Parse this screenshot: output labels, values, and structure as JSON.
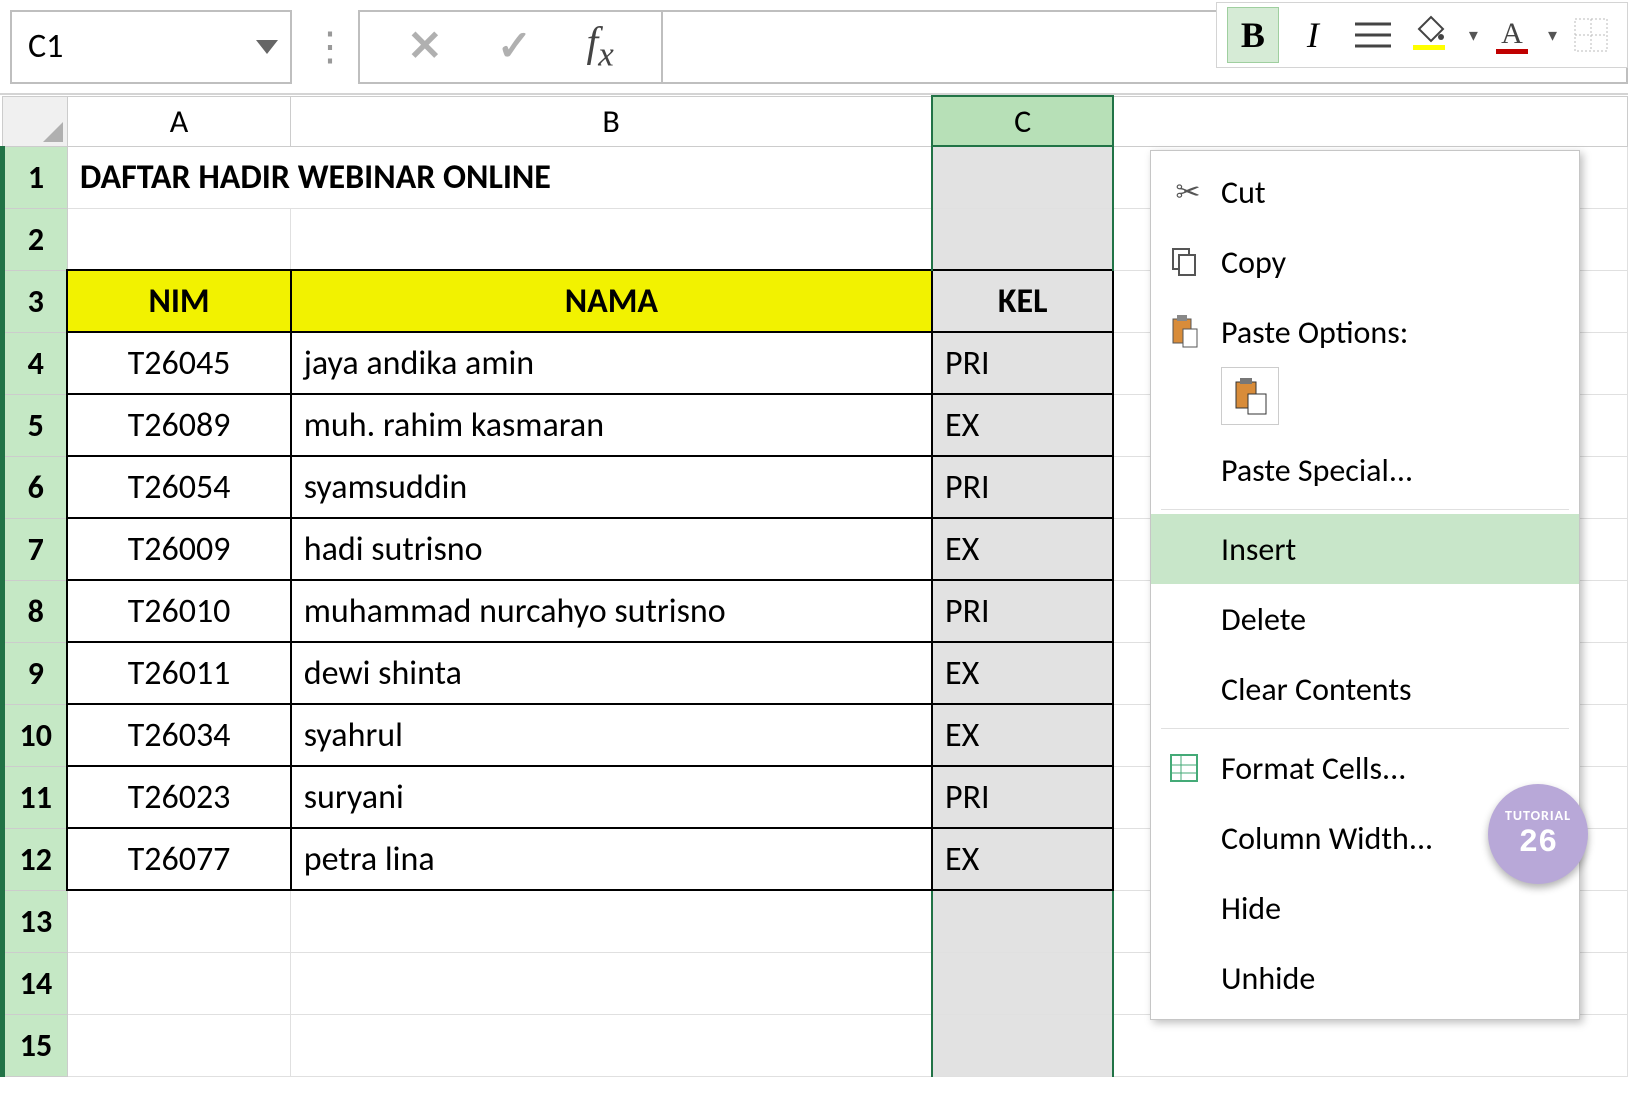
{
  "name_box": "C1",
  "formula_value": "",
  "mini_toolbar": {
    "bold": "B",
    "italic": "I"
  },
  "columns": [
    "A",
    "B",
    "C"
  ],
  "rows_visible": [
    "1",
    "2",
    "3",
    "4",
    "5",
    "6",
    "7",
    "8",
    "9",
    "10",
    "11",
    "12",
    "13",
    "14",
    "15"
  ],
  "selected_column": "C",
  "sheet_title": "DAFTAR HADIR WEBINAR ONLINE",
  "headers": {
    "nim": "NIM",
    "nama": "NAMA",
    "kelas": "KEL"
  },
  "data_rows": [
    {
      "nim": "T26045",
      "nama": "jaya andika amin",
      "kel": "PRI"
    },
    {
      "nim": "T26089",
      "nama": "muh. rahim kasmaran",
      "kel": "EX"
    },
    {
      "nim": "T26054",
      "nama": "syamsuddin",
      "kel": "PRI"
    },
    {
      "nim": "T26009",
      "nama": "hadi sutrisno",
      "kel": "EX"
    },
    {
      "nim": "T26010",
      "nama": "muhammad nurcahyo sutrisno",
      "kel": "PRI"
    },
    {
      "nim": "T26011",
      "nama": "dewi shinta",
      "kel": "EX"
    },
    {
      "nim": "T26034",
      "nama": "syahrul",
      "kel": "EX"
    },
    {
      "nim": "T26023",
      "nama": "suryani",
      "kel": "PRI"
    },
    {
      "nim": "T26077",
      "nama": "petra lina",
      "kel": "EX"
    }
  ],
  "context_menu": {
    "cut": "Cut",
    "copy": "Copy",
    "paste_options": "Paste Options:",
    "paste_special": "Paste Special...",
    "insert": "Insert",
    "delete": "Delete",
    "clear": "Clear Contents",
    "format_cells": "Format Cells...",
    "column_width": "Column Width...",
    "hide": "Hide",
    "unhide": "Unhide"
  },
  "badge": {
    "line1": "TUTORIAL",
    "line2": "26"
  }
}
